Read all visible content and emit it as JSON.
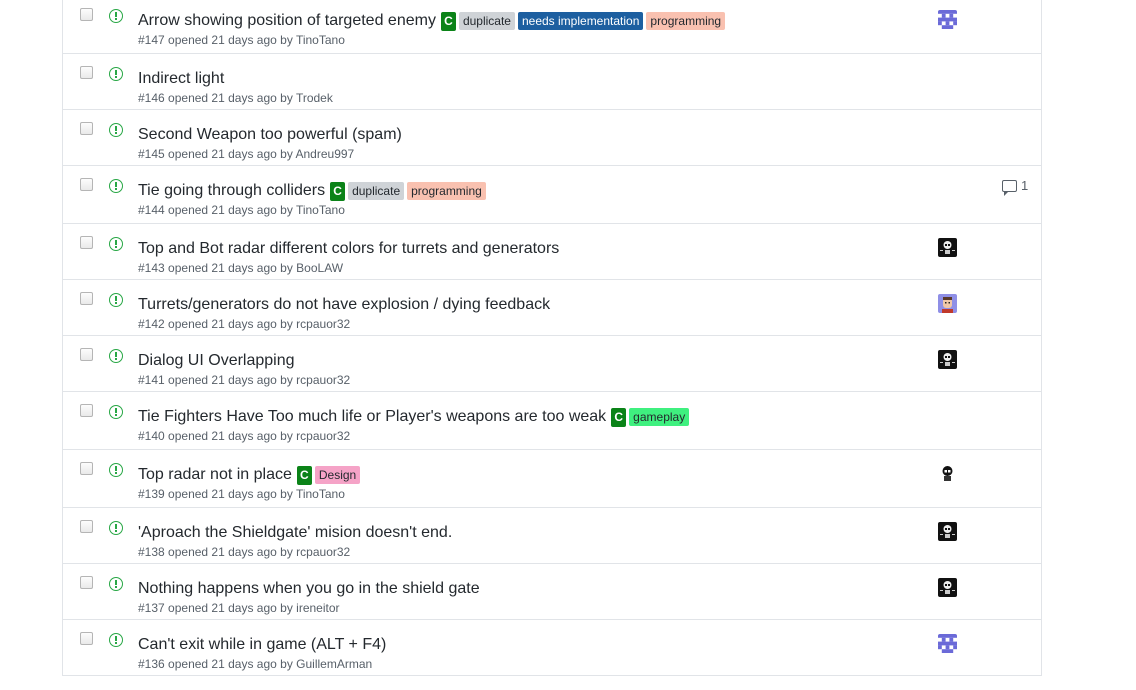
{
  "issues": [
    {
      "title": "Arrow showing position of targeted enemy",
      "number": "#147",
      "opened": "opened 21 days ago by",
      "author": "TinoTano",
      "lang": "C",
      "labels": [
        {
          "text": "duplicate",
          "bg": "#cfd3d7",
          "fg": "#24292e"
        },
        {
          "text": "needs implementation",
          "bg": "#1d5fa0",
          "fg": "#ffffff"
        },
        {
          "text": "programming",
          "bg": "#f9c1b0",
          "fg": "#24292e"
        }
      ],
      "avatar": "pixel-avatar-blue",
      "comments": ""
    },
    {
      "title": "Indirect light",
      "number": "#146",
      "opened": "opened 21 days ago by",
      "author": "Trodek",
      "lang": "",
      "labels": [],
      "avatar": "",
      "comments": ""
    },
    {
      "title": "Second Weapon too powerful (spam)",
      "number": "#145",
      "opened": "opened 21 days ago by",
      "author": "Andreu997",
      "lang": "",
      "labels": [],
      "avatar": "",
      "comments": ""
    },
    {
      "title": "Tie going through colliders",
      "number": "#144",
      "opened": "opened 21 days ago by",
      "author": "TinoTano",
      "lang": "C",
      "labels": [
        {
          "text": "duplicate",
          "bg": "#cfd3d7",
          "fg": "#24292e"
        },
        {
          "text": "programming",
          "bg": "#f9c1b0",
          "fg": "#24292e"
        }
      ],
      "avatar": "",
      "comments": "1"
    },
    {
      "title": "Top and Bot radar different colors for turrets and generators",
      "number": "#143",
      "opened": "opened 21 days ago by",
      "author": "BooLAW",
      "lang": "",
      "labels": [],
      "avatar": "skull-avatar",
      "comments": ""
    },
    {
      "title": "Turrets/generators do not have explosion / dying feedback",
      "number": "#142",
      "opened": "opened 21 days ago by",
      "author": "rcpauor32",
      "lang": "",
      "labels": [],
      "avatar": "face-avatar",
      "comments": ""
    },
    {
      "title": "Dialog UI Overlapping",
      "number": "#141",
      "opened": "opened 21 days ago by",
      "author": "rcpauor32",
      "lang": "",
      "labels": [],
      "avatar": "skull-avatar",
      "comments": ""
    },
    {
      "title": "Tie Fighters Have Too much life or Player's weapons are too weak",
      "number": "#140",
      "opened": "opened 21 days ago by",
      "author": "rcpauor32",
      "lang": "C",
      "labels": [
        {
          "text": "gameplay",
          "bg": "#3ff07f",
          "fg": "#24292e"
        }
      ],
      "avatar": "",
      "comments": ""
    },
    {
      "title": "Top radar not in place",
      "number": "#139",
      "opened": "opened 21 days ago by",
      "author": "TinoTano",
      "lang": "C",
      "labels": [
        {
          "text": "Design",
          "bg": "#f5a3c7",
          "fg": "#24292e"
        }
      ],
      "avatar": "skull-avatar-white",
      "comments": ""
    },
    {
      "title": "'Aproach the Shieldgate' mision doesn't end.",
      "number": "#138",
      "opened": "opened 21 days ago by",
      "author": "rcpauor32",
      "lang": "",
      "labels": [],
      "avatar": "skull-avatar",
      "comments": ""
    },
    {
      "title": "Nothing happens when you go in the shield gate",
      "number": "#137",
      "opened": "opened 21 days ago by",
      "author": "ireneitor",
      "lang": "",
      "labels": [],
      "avatar": "skull-avatar",
      "comments": ""
    },
    {
      "title": "Can't exit while in game (ALT + F4)",
      "number": "#136",
      "opened": "opened 21 days ago by",
      "author": "GuillemArman",
      "lang": "",
      "labels": [],
      "avatar": "pixel-avatar-blue",
      "comments": ""
    }
  ]
}
